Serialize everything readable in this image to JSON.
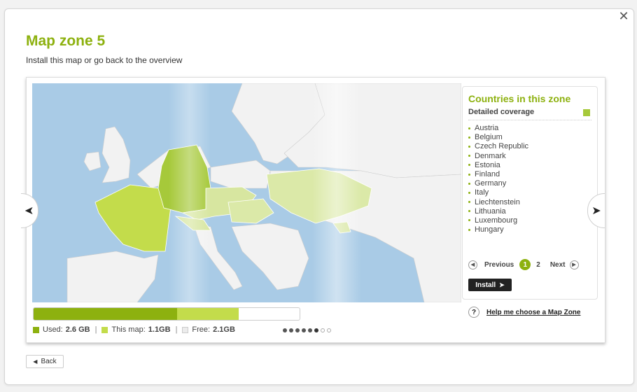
{
  "dialog": {
    "close_icon": "close-icon",
    "title": "Map zone 5",
    "subtitle": "Install this map or go back to the overview"
  },
  "map": {
    "sea_color": "#a9cbe6",
    "land_color": "#f2f2f2",
    "detailed_color": "#a6c93a",
    "dark_color": "#8db10f",
    "light_color": "#d7e6a0"
  },
  "panel": {
    "title": "Countries in this zone",
    "coverage_label": "Detailed coverage",
    "countries": [
      "Austria",
      "Belgium",
      "Czech Republic",
      "Denmark",
      "Estonia",
      "Finland",
      "Germany",
      "Italy",
      "Liechtenstein",
      "Lithuania",
      "Luxembourg",
      "Hungary"
    ],
    "pager": {
      "previous": "Previous",
      "current": "1",
      "next_page": "2",
      "next": "Next"
    },
    "install_label": "Install"
  },
  "help": {
    "icon": "?",
    "label": "Help me choose a Map Zone"
  },
  "storage": {
    "used_label": "Used:",
    "used_value": "2.6 GB",
    "used_fraction": 0.54,
    "thismap_label": "This map:",
    "thismap_value": "1.1GB",
    "thismap_fraction": 0.23,
    "free_label": "Free:",
    "free_value": "2.1GB",
    "colors": {
      "used": "#8db10f",
      "thismap": "#c3dc4b",
      "free": "#ececec"
    }
  },
  "carousel": {
    "total": 8,
    "active": 6
  },
  "back_label": "Back"
}
